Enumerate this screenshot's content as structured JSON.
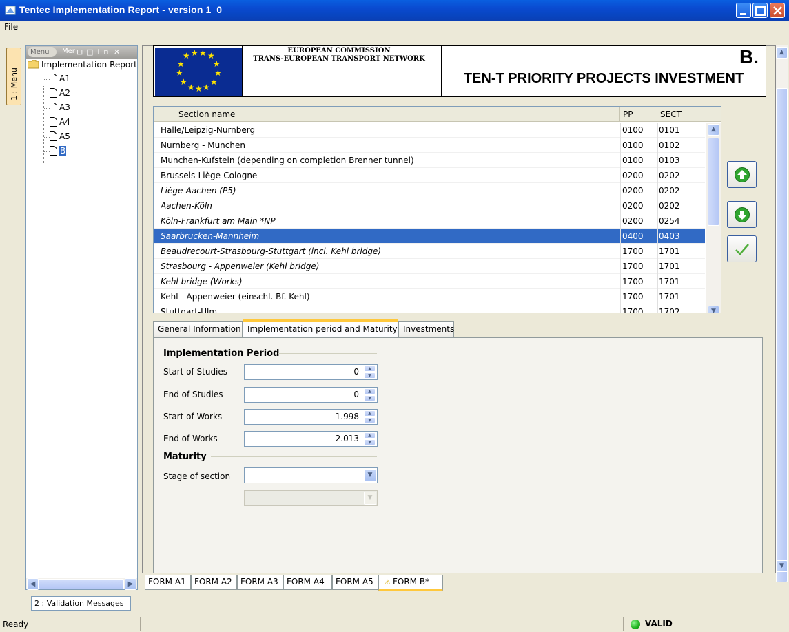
{
  "window": {
    "title": "Tentec Implementation Report - version 1_0"
  },
  "menubar": {
    "file": "File"
  },
  "sidebar": {
    "vertical_tab": "1 : Menu",
    "header_tab": "Menu",
    "header_tab2": "Mer",
    "tree_root": "Implementation Report",
    "items": [
      {
        "label": "A1"
      },
      {
        "label": "A2"
      },
      {
        "label": "A3"
      },
      {
        "label": "A4"
      },
      {
        "label": "A5"
      },
      {
        "label": "B",
        "selected": true
      }
    ],
    "validation_button": "2 : Validation Messages"
  },
  "header": {
    "line1": "EUROPEAN COMMISSION",
    "line2": "TRANS-EUROPEAN TRANSPORT NETWORK",
    "letter": "B.",
    "title": "TEN-T PRIORITY PROJECTS INVESTMENT"
  },
  "table": {
    "columns": [
      "Section name",
      "PP",
      "SECT"
    ],
    "rows": [
      {
        "name": "Halle/Leipzig-Nurnberg",
        "pp": "0100",
        "sect": "0101",
        "italic": false
      },
      {
        "name": "Nurnberg - Munchen",
        "pp": "0100",
        "sect": "0102",
        "italic": false
      },
      {
        "name": "Munchen-Kufstein (depending on completion Brenner tunnel)",
        "pp": "0100",
        "sect": "0103",
        "italic": false
      },
      {
        "name": "Brussels-Liège-Cologne",
        "pp": "0200",
        "sect": "0202",
        "italic": false
      },
      {
        "name": "Liège-Aachen (P5)",
        "pp": "0200",
        "sect": "0202",
        "italic": true
      },
      {
        "name": "Aachen-Köln",
        "pp": "0200",
        "sect": "0202",
        "italic": true
      },
      {
        "name": "Köln-Frankfurt am Main *NP",
        "pp": "0200",
        "sect": "0254",
        "italic": true
      },
      {
        "name": "Saarbrucken-Mannheim",
        "pp": "0400",
        "sect": "0403",
        "italic": true,
        "selected": true
      },
      {
        "name": "Beaudrecourt-Strasbourg-Stuttgart (incl. Kehl bridge)",
        "pp": "1700",
        "sect": "1701",
        "italic": true
      },
      {
        "name": "Strasbourg - Appenweier (Kehl bridge)",
        "pp": "1700",
        "sect": "1701",
        "italic": true
      },
      {
        "name": "Kehl bridge (Works)",
        "pp": "1700",
        "sect": "1701",
        "italic": true
      },
      {
        "name": "Kehl - Appenweier (einschl. Bf. Kehl)",
        "pp": "1700",
        "sect": "1701",
        "italic": false
      },
      {
        "name": "Stuttgart-Ulm",
        "pp": "1700",
        "sect": "1702",
        "italic": false
      }
    ]
  },
  "tabs": [
    {
      "label": "General Information"
    },
    {
      "label": "Implementation period and Maturity",
      "active": true
    },
    {
      "label": "Investments"
    }
  ],
  "form": {
    "period_heading": "Implementation Period",
    "start_studies_label": "Start of Studies",
    "start_studies_value": "0",
    "end_studies_label": "End of Studies",
    "end_studies_value": "0",
    "start_works_label": "Start of Works",
    "start_works_value": "1.998",
    "end_works_label": "End of Works",
    "end_works_value": "2.013",
    "maturity_heading": "Maturity",
    "stage_label": "Stage of section",
    "stage_value": "",
    "sub_value": ""
  },
  "form_tabs": [
    {
      "label": "FORM A1"
    },
    {
      "label": "FORM A2"
    },
    {
      "label": "FORM A3"
    },
    {
      "label": "FORM A4"
    },
    {
      "label": "FORM A5"
    },
    {
      "label": "FORM B*",
      "active": true,
      "warning": true
    }
  ],
  "status": {
    "left": "Ready",
    "right": "VALID",
    "valid_color": "#1db11d"
  },
  "colors": {
    "title_bar": "#0a4ad0",
    "selection": "#316ac5",
    "active_tab_accent": "#ffc83c"
  }
}
